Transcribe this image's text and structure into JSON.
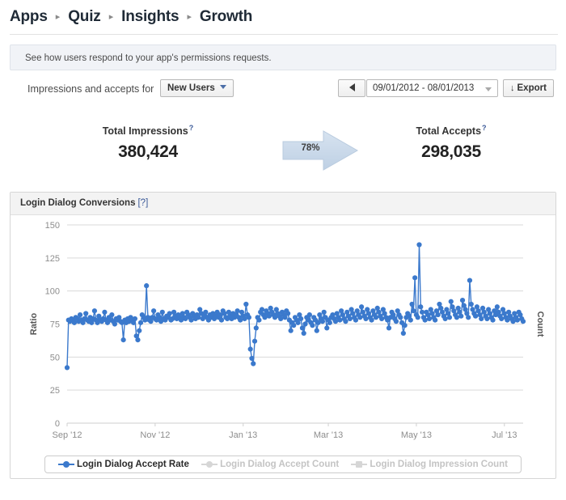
{
  "breadcrumb": {
    "separator": "▸",
    "items": [
      {
        "label": "Apps"
      },
      {
        "label": "Quiz"
      },
      {
        "label": "Insights"
      },
      {
        "label": "Growth"
      }
    ]
  },
  "info_banner": {
    "text": "See how users respond to your app's permissions requests."
  },
  "controls": {
    "impressions_label": "Impressions and accepts for",
    "segment_value": "New Users",
    "prev_period_icon": "triangle-left-icon",
    "date_range_value": "09/01/2012 - 08/01/2013",
    "date_range_caret": "chevron-down-icon",
    "export_label": "Export",
    "export_icon": "↓"
  },
  "summary": {
    "impressions": {
      "label": "Total Impressions",
      "help": "?",
      "value": "380,424"
    },
    "conversion": {
      "percent_label": "78%",
      "arrow_icon": "right-arrow-icon",
      "arrow_color": "#c6d8ea"
    },
    "accepts": {
      "label": "Total Accepts",
      "help": "?",
      "value": "298,035"
    }
  },
  "chart_panel": {
    "title": "Login Dialog Conversions",
    "help_label": "[?]"
  },
  "legend": {
    "items": [
      {
        "label": "Login Dialog Accept Rate",
        "state": "active",
        "marker": "circle",
        "color": "#3b79cc"
      },
      {
        "label": "Login Dialog Accept Count",
        "state": "inactive",
        "marker": "circle",
        "color": "#d6d6d6"
      },
      {
        "label": "Login Dialog Impression Count",
        "state": "inactive",
        "marker": "square",
        "color": "#d6d6d6"
      }
    ]
  },
  "chart_data": {
    "type": "line",
    "title": "Login Dialog Conversions",
    "xlabel": "",
    "ylabel": "Ratio",
    "y2label": "Count",
    "ylim": [
      0,
      150
    ],
    "yticks": [
      0,
      25,
      50,
      75,
      100,
      125,
      150
    ],
    "ytick_labels": [
      "0",
      "25",
      "50",
      "75",
      "100",
      "125",
      "150"
    ],
    "xticks": [
      0,
      61,
      122,
      181,
      242,
      303
    ],
    "xtick_labels": [
      "Sep '12",
      "Nov '12",
      "Jan '13",
      "Mar '13",
      "May '13",
      "Jul '13"
    ],
    "grid": true,
    "legend_position": "bottom",
    "marker": "circle",
    "series": [
      {
        "name": "Login Dialog Accept Rate",
        "color": "#3b79cc",
        "visible": true,
        "units": "percent",
        "x_start": "2012-09-01",
        "x_end": "2013-08-01",
        "values": [
          42,
          78,
          77,
          79,
          78,
          76,
          80,
          79,
          77,
          82,
          78,
          76,
          79,
          83,
          78,
          77,
          80,
          76,
          79,
          85,
          78,
          76,
          81,
          78,
          77,
          79,
          84,
          78,
          76,
          80,
          78,
          82,
          77,
          75,
          79,
          78,
          80,
          77,
          76,
          63,
          78,
          76,
          79,
          77,
          80,
          78,
          76,
          79,
          66,
          63,
          70,
          76,
          82,
          80,
          78,
          104,
          80,
          78,
          77,
          80,
          85,
          79,
          78,
          82,
          80,
          77,
          84,
          79,
          78,
          81,
          80,
          83,
          78,
          79,
          84,
          81,
          79,
          82,
          80,
          78,
          83,
          80,
          79,
          84,
          82,
          80,
          78,
          83,
          81,
          79,
          82,
          80,
          86,
          83,
          79,
          81,
          84,
          80,
          78,
          82,
          80,
          83,
          79,
          81,
          84,
          80,
          82,
          78,
          85,
          83,
          80,
          79,
          84,
          81,
          79,
          83,
          80,
          82,
          85,
          80,
          78,
          84,
          81,
          79,
          90,
          82,
          80,
          56,
          49,
          45,
          62,
          72,
          80,
          78,
          84,
          86,
          82,
          80,
          85,
          83,
          81,
          87,
          84,
          82,
          80,
          86,
          83,
          81,
          79,
          84,
          82,
          80,
          85,
          83,
          78,
          70,
          76,
          74,
          80,
          78,
          76,
          82,
          79,
          72,
          68,
          75,
          80,
          78,
          82,
          76,
          74,
          80,
          78,
          70,
          76,
          82,
          79,
          77,
          84,
          80,
          72,
          78,
          76,
          80,
          82,
          79,
          77,
          83,
          80,
          78,
          85,
          82,
          79,
          77,
          84,
          81,
          79,
          86,
          83,
          80,
          78,
          85,
          82,
          80,
          88,
          84,
          81,
          79,
          86,
          83,
          80,
          78,
          85,
          82,
          80,
          87,
          84,
          81,
          79,
          86,
          83,
          80,
          78,
          72,
          80,
          84,
          82,
          79,
          77,
          85,
          82,
          80,
          76,
          68,
          74,
          80,
          83,
          81,
          78,
          90,
          85,
          110,
          82,
          80,
          135,
          88,
          84,
          80,
          78,
          84,
          82,
          79,
          86,
          83,
          80,
          78,
          85,
          82,
          90,
          87,
          84,
          81,
          79,
          86,
          83,
          80,
          92,
          88,
          85,
          82,
          80,
          87,
          84,
          81,
          93,
          89,
          86,
          83,
          80,
          108,
          90,
          86,
          83,
          81,
          88,
          85,
          82,
          79,
          87,
          84,
          81,
          79,
          86,
          83,
          80,
          78,
          85,
          82,
          88,
          84,
          81,
          79,
          86,
          83,
          80,
          78,
          84,
          81,
          79,
          77,
          83,
          80,
          78,
          84,
          82,
          79,
          77
        ]
      },
      {
        "name": "Login Dialog Accept Count",
        "color": "#d6d6d6",
        "visible": false,
        "values": []
      },
      {
        "name": "Login Dialog Impression Count",
        "color": "#d6d6d6",
        "visible": false,
        "values": []
      }
    ]
  }
}
